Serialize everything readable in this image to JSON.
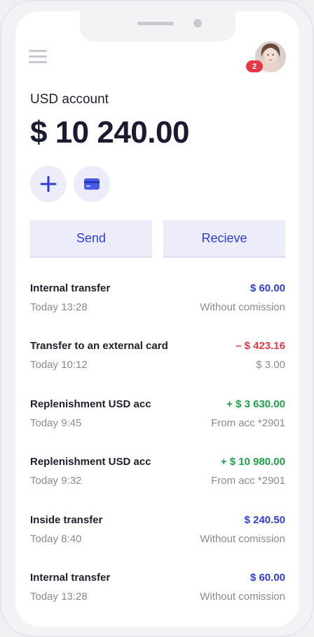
{
  "account": {
    "label": "USD account",
    "balance": "$ 10 240.00"
  },
  "header": {
    "notification_count": "2",
    "menu_icon": "hamburger-menu-icon",
    "avatar": "user-avatar"
  },
  "quick_actions": {
    "add_icon": "plus-icon",
    "card_icon": "credit-card-icon"
  },
  "buttons": {
    "send": "Send",
    "receive": "Recieve"
  },
  "colors": {
    "accent": "#2e3dd4",
    "positive": "#1fa049",
    "negative": "#e53945",
    "neutral_amount": "#2e3dd4",
    "button_bg": "#ececfb"
  },
  "transactions": [
    {
      "title": "Internal transfer",
      "amount": "$ 60.00",
      "time": "Today 13:28",
      "note": "Without comission",
      "type": "neutral"
    },
    {
      "title": "Transfer to an external card",
      "amount": "– $ 423.16",
      "time": "Today 10:12",
      "note": "$ 3.00",
      "type": "negative"
    },
    {
      "title": "Replenishment USD acc",
      "amount": "+ $ 3 630.00",
      "time": "Today 9:45",
      "note": "From acc *2901",
      "type": "positive"
    },
    {
      "title": "Replenishment USD acc",
      "amount": "+ $ 10 980.00",
      "time": "Today 9:32",
      "note": "From acc *2901",
      "type": "positive"
    },
    {
      "title": "Inside transfer",
      "amount": "$ 240.50",
      "time": "Today 8:40",
      "note": "Without comission",
      "type": "neutral"
    },
    {
      "title": "Internal transfer",
      "amount": "$ 60.00",
      "time": "Today 13:28",
      "note": "Without comission",
      "type": "neutral"
    }
  ]
}
